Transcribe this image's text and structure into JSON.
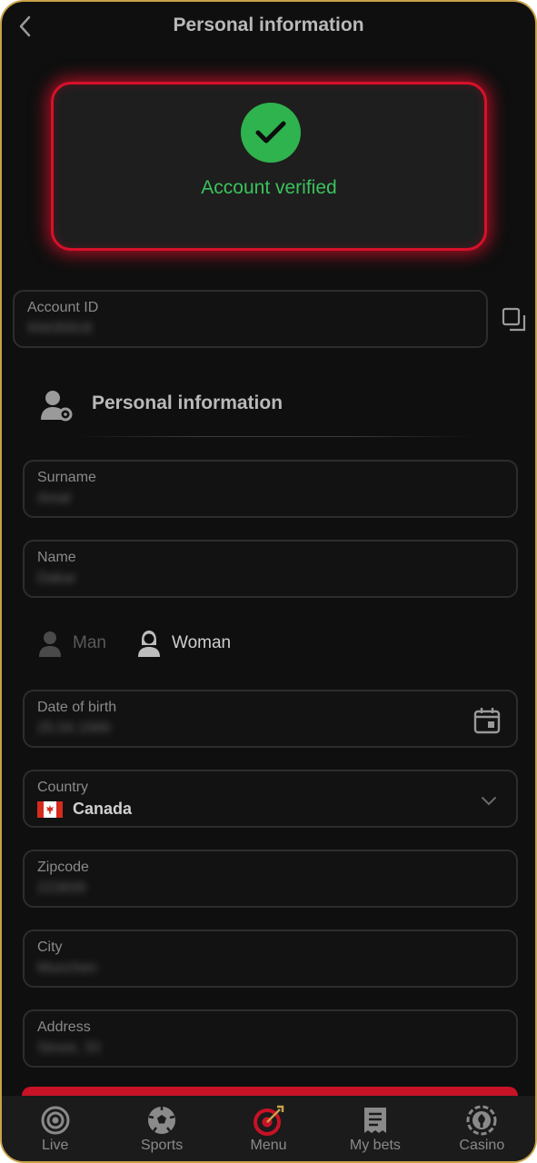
{
  "header": {
    "title": "Personal information",
    "back_icon": "chevron-left-icon"
  },
  "verification": {
    "status_text": "Account verified",
    "icon": "check-circle-icon",
    "status_color": "#39c35c",
    "glow_color": "#d8102a"
  },
  "account": {
    "label": "Account ID",
    "value": "93435918",
    "copy_icon": "copy-icon"
  },
  "section": {
    "title": "Personal information",
    "icon": "user-settings-icon"
  },
  "fields": {
    "surname": {
      "label": "Surname",
      "value": "Amal"
    },
    "name": {
      "label": "Name",
      "value": "Dakar"
    },
    "dob": {
      "label": "Date of birth",
      "value": "25.04.1999"
    },
    "country": {
      "label": "Country",
      "value": "Canada"
    },
    "zipcode": {
      "label": "Zipcode",
      "value": "223839"
    },
    "city": {
      "label": "City",
      "value": "Munchen"
    },
    "address": {
      "label": "Address",
      "value": "Street, 33"
    }
  },
  "gender": {
    "options": [
      {
        "label": "Man",
        "selected": false
      },
      {
        "label": "Woman",
        "selected": true
      }
    ]
  },
  "nav": {
    "items": [
      {
        "label": "Live",
        "icon": "live-icon"
      },
      {
        "label": "Sports",
        "icon": "soccer-ball-icon"
      },
      {
        "label": "Menu",
        "icon": "target-dart-icon"
      },
      {
        "label": "My bets",
        "icon": "receipt-icon"
      },
      {
        "label": "Casino",
        "icon": "casino-chip-icon"
      }
    ],
    "active_color": "#c81226"
  }
}
